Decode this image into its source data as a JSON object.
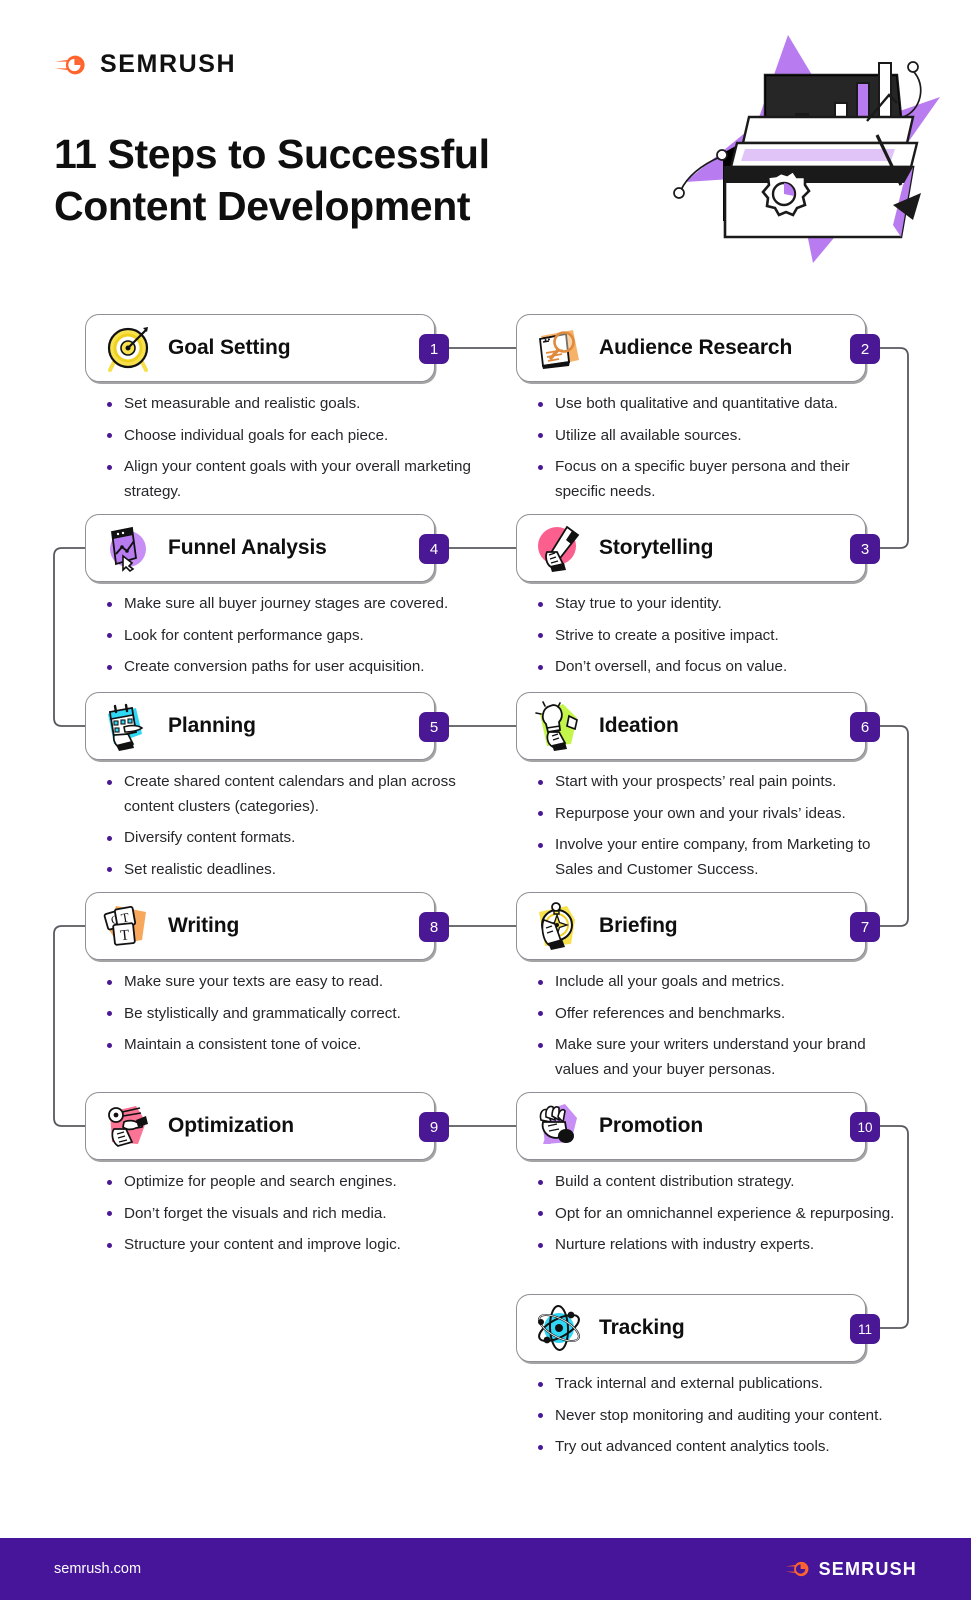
{
  "brand": {
    "name": "SEMRUSH",
    "logo_icon": "semrush-comet-icon",
    "accent_orange": "#ff642d",
    "accent_purple": "#4a1894",
    "footer_purple": "#46159a"
  },
  "header": {
    "title_line1": "11 Steps to Successful",
    "title_line2": "Content Development",
    "hero_icon": "open-toolbox-with-bar-chart-and-gear-illustration"
  },
  "steps": [
    {
      "number": "1",
      "title": "Goal Setting",
      "icon": "yellow-dartboard-target-icon",
      "side": "left",
      "bullets": [
        "Set measurable and realistic goals.",
        "Choose individual goals for each piece.",
        "Align your content goals with your overall marketing strategy."
      ]
    },
    {
      "number": "2",
      "title": "Audience Research",
      "icon": "orange-book-with-magnifier-icon",
      "side": "right",
      "bullets": [
        "Use both qualitative and quantitative data.",
        "Utilize all available sources.",
        "Focus on a specific buyer persona and their specific needs."
      ]
    },
    {
      "number": "3",
      "title": "Storytelling",
      "icon": "pink-hand-holding-pencil-icon",
      "side": "right",
      "bullets": [
        "Stay true to your identity.",
        "Strive to create a positive impact.",
        "Don’t oversell, and focus on value."
      ]
    },
    {
      "number": "4",
      "title": "Funnel Analysis",
      "icon": "purple-chart-funnel-icon",
      "side": "left",
      "bullets": [
        "Make sure all buyer journey stages are covered.",
        "Look for content performance gaps.",
        "Create conversion paths for user acquisition."
      ]
    },
    {
      "number": "5",
      "title": "Planning",
      "icon": "cyan-calendar-hand-icon",
      "side": "left",
      "bullets": [
        "Create shared content calendars and plan across content clusters (categories).",
        "Diversify content formats.",
        "Set realistic deadlines."
      ]
    },
    {
      "number": "6",
      "title": "Ideation",
      "icon": "green-hand-with-lightbulb-icon",
      "side": "right",
      "bullets": [
        "Start with your prospects’ real pain points.",
        "Repurpose your own and your rivals’ ideas.",
        "Involve your entire company, from Marketing to Sales and Customer Success."
      ]
    },
    {
      "number": "7",
      "title": "Briefing",
      "icon": "yellow-stopwatch-compass-icon",
      "side": "right",
      "bullets": [
        "Include all your goals and metrics.",
        "Offer references and benchmarks.",
        "Make sure your writers understand your brand values and your buyer personas."
      ]
    },
    {
      "number": "8",
      "title": "Writing",
      "icon": "orange-letter-blocks-icon",
      "side": "left",
      "bullets": [
        "Make sure your texts are easy to read.",
        "Be stylistically and grammatically correct.",
        "Maintain a consistent tone of voice."
      ]
    },
    {
      "number": "9",
      "title": "Optimization",
      "icon": "pink-hands-wrench-icon",
      "side": "left",
      "bullets": [
        "Optimize for people and search engines.",
        "Don’t forget the visuals and rich media.",
        "Structure your content and improve logic."
      ]
    },
    {
      "number": "10",
      "title": "Promotion",
      "icon": "purple-hands-megaphone-icon",
      "side": "right",
      "bullets": [
        "Build a content distribution strategy.",
        "Opt for an omnichannel experience & repurposing.",
        "Nurture relations with industry experts."
      ]
    },
    {
      "number": "11",
      "title": "Tracking",
      "icon": "cyan-atom-icon",
      "side": "right",
      "bullets": [
        "Track internal and external publications.",
        "Never stop monitoring and auditing your content.",
        "Try out advanced content analytics tools."
      ]
    }
  ],
  "footer": {
    "url": "semrush.com",
    "brand": "SEMRUSH",
    "logo_icon": "semrush-comet-icon"
  }
}
